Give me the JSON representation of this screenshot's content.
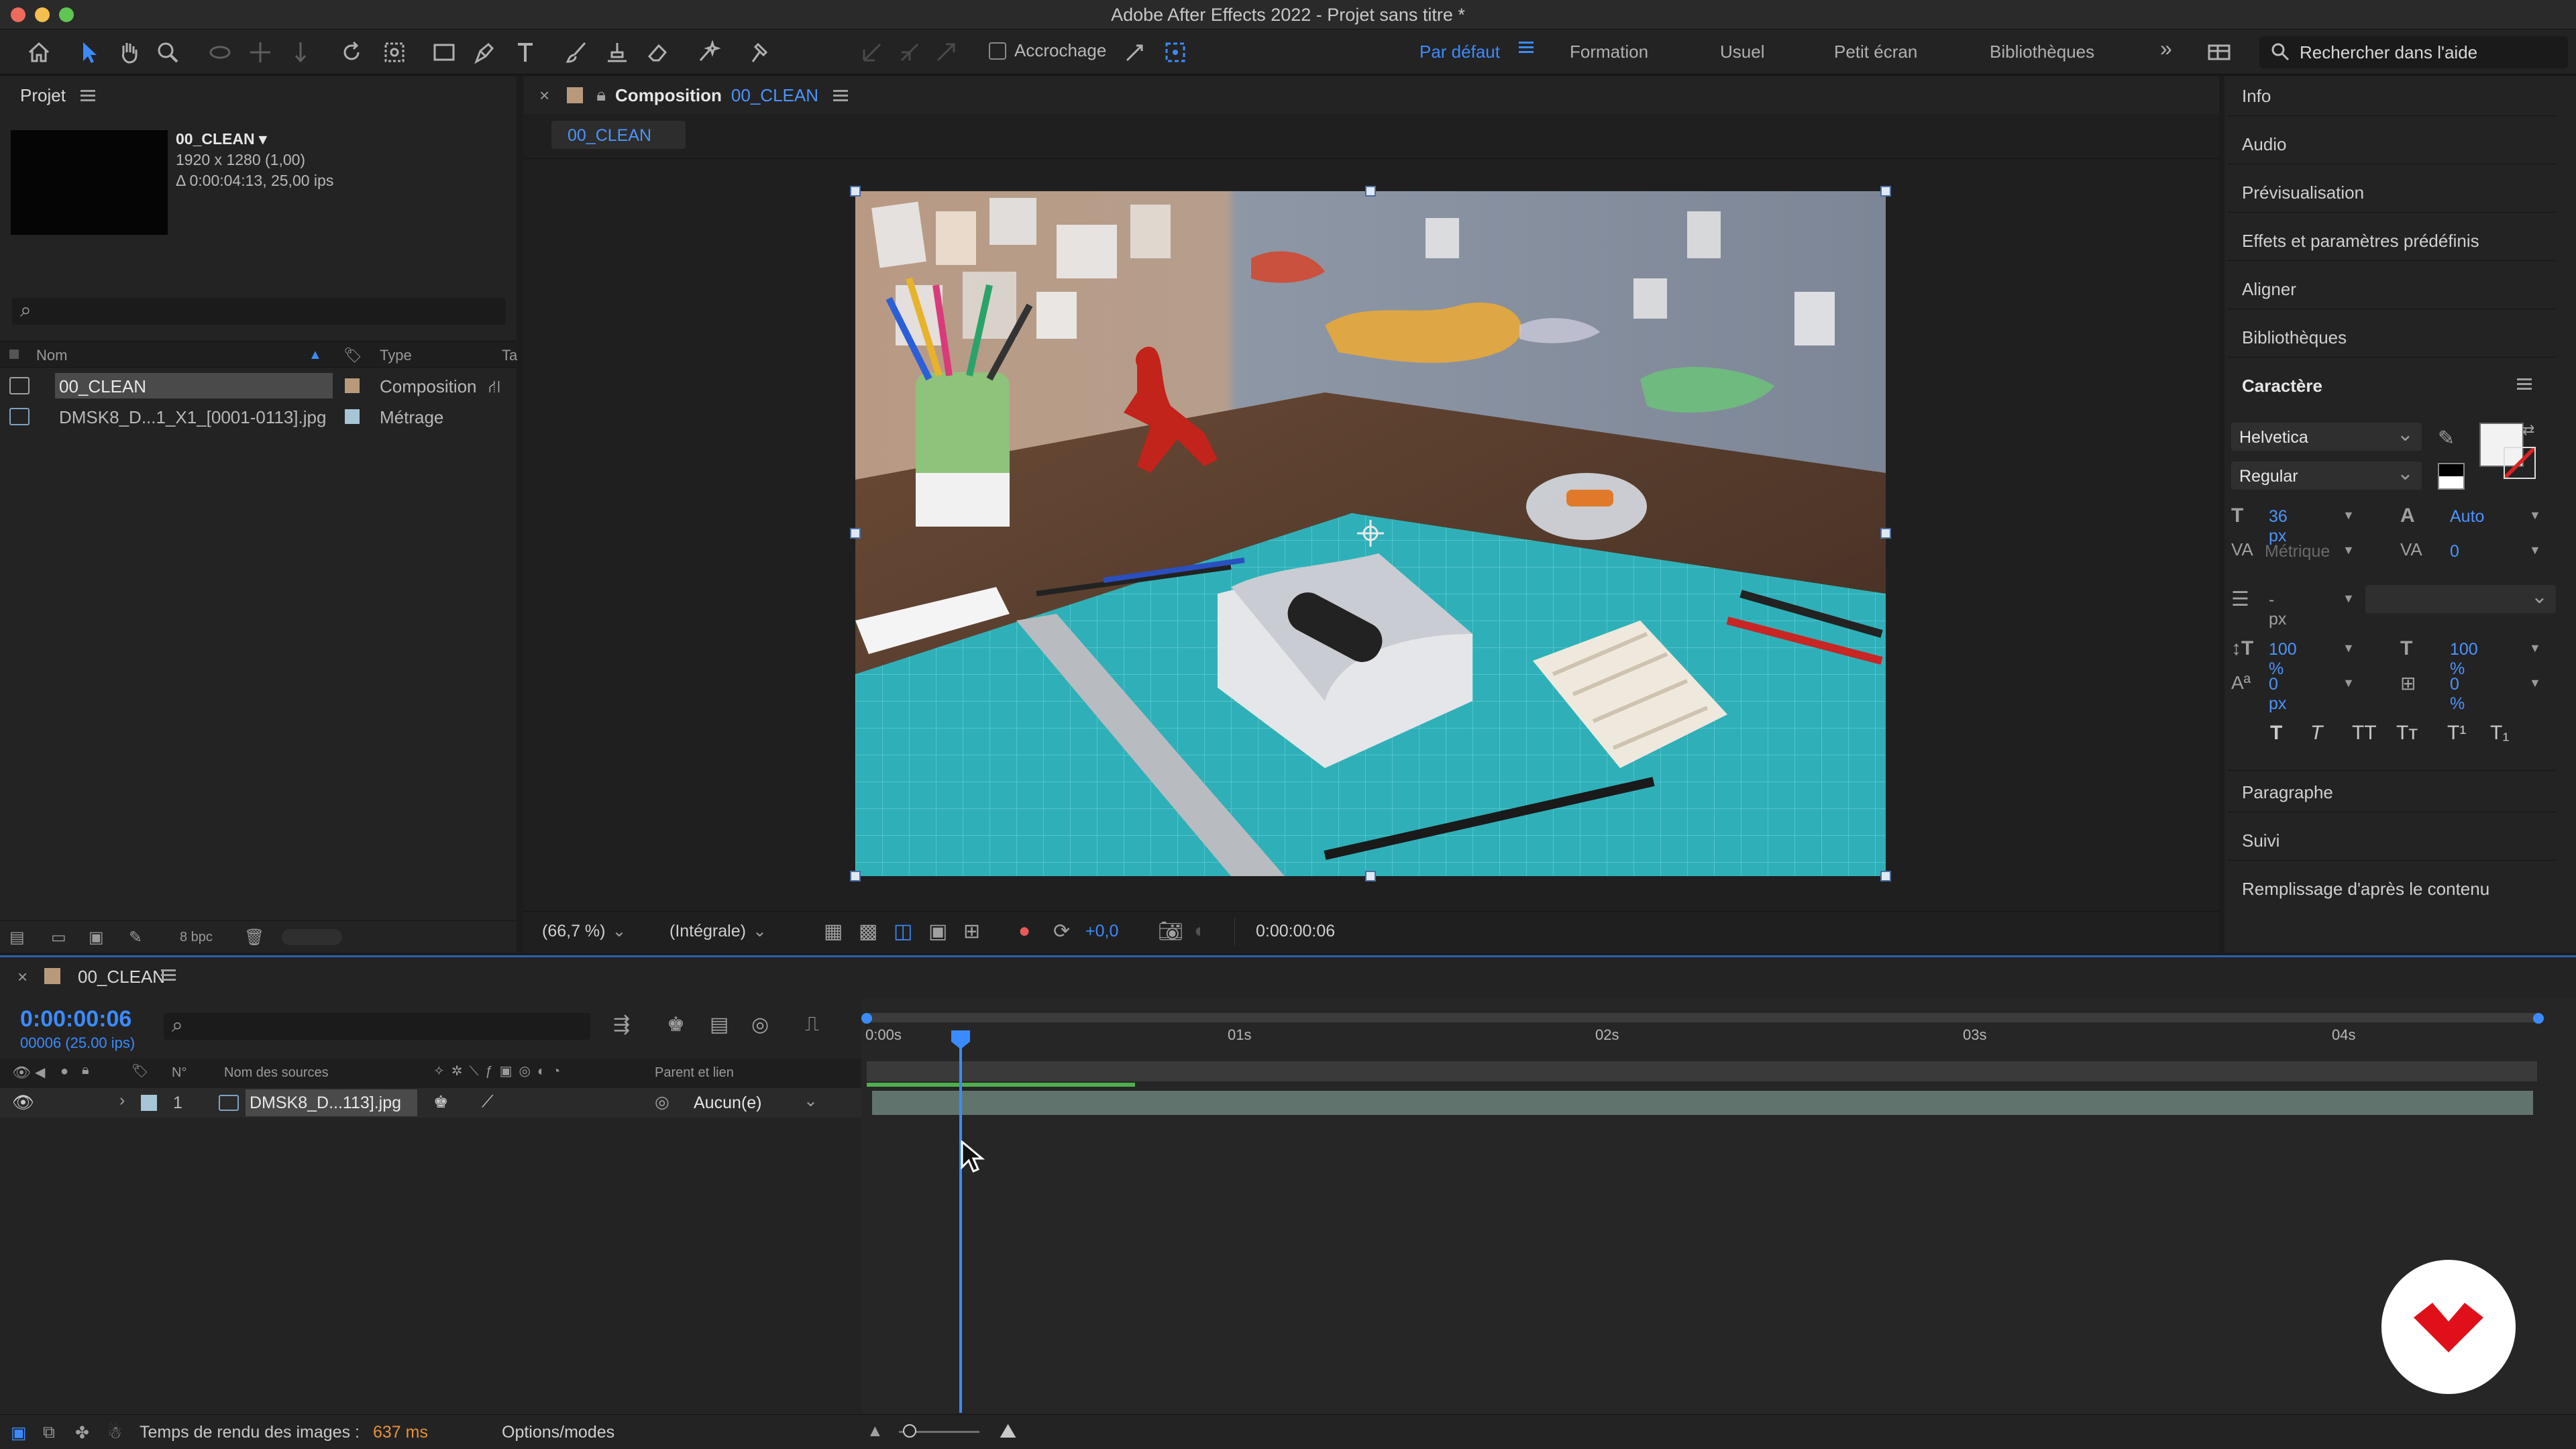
{
  "window": {
    "title": "Adobe After Effects 2022 - Projet sans titre *"
  },
  "toolbar": {
    "snap_label": "Accrochage",
    "workspaces": [
      "Par défaut",
      "Formation",
      "Usuel",
      "Petit écran",
      "Bibliothèques"
    ],
    "active_workspace": "Par défaut",
    "help_placeholder": "Rechercher dans l'aide",
    "more": "»"
  },
  "project": {
    "title": "Projet",
    "selected_name": "00_CLEAN ▾",
    "selected_dims": "1920 x 1280 (1,00)",
    "selected_duration": "Δ 0:00:04:13, 25,00 ips",
    "search_icon_label": "⌕",
    "columns": {
      "name": "Nom",
      "type": "Type",
      "extra": "Ta"
    },
    "items": [
      {
        "name": "00_CLEAN",
        "type": "Composition",
        "color": "#b89a7a"
      },
      {
        "name": "DMSK8_D...1_X1_[0001-0113].jpg",
        "type": "Métrage",
        "color": "#a6c6d6"
      }
    ],
    "bit_depth": "8 bpc"
  },
  "composition": {
    "tab_prefix": "Composition",
    "comp_name": "00_CLEAN",
    "subtab": "00_CLEAN",
    "zoom": "(66,7 %)",
    "resolution": "(Intégrale)",
    "exposure": "+0,0",
    "timecode": "0:00:00:06"
  },
  "right_panel": {
    "items_top": [
      "Info",
      "Audio",
      "Prévisualisation",
      "Effets et paramètres prédéfinis",
      "Aligner",
      "Bibliothèques"
    ],
    "character": {
      "title": "Caractère",
      "font": "Helvetica",
      "style": "Regular",
      "size": "36 px",
      "leading": "Auto",
      "kerning": "Métrique",
      "tracking": "0",
      "stroke": "- px",
      "vscale": "100 %",
      "hscale": "100 %",
      "baseline": "0 px",
      "tsume": "0 %",
      "styles": [
        "T",
        "T",
        "TT",
        "Tт",
        "T¹",
        "T₁"
      ]
    },
    "items_bottom": [
      "Paragraphe",
      "Suivi",
      "Remplissage d'après le contenu"
    ]
  },
  "timeline": {
    "tab_name": "00_CLEAN",
    "timecode": "0:00:00:06",
    "frames": "00006 (25.00 ips)",
    "header": {
      "num": "N°",
      "source": "Nom des sources",
      "parent": "Parent et lien"
    },
    "layer": {
      "num": "1",
      "name": "DMSK8_D...113].jpg",
      "parent": "Aucun(e)"
    },
    "ruler_labels": [
      "0:00s",
      "01s",
      "02s",
      "03s",
      "04s"
    ]
  },
  "status": {
    "render_label": "Temps de rendu des images :",
    "render_value": "637 ms",
    "options": "Options/modes"
  },
  "colors": {
    "accent": "#3b8bff",
    "render_value": "#e8913a",
    "logo": "#e0101a"
  }
}
